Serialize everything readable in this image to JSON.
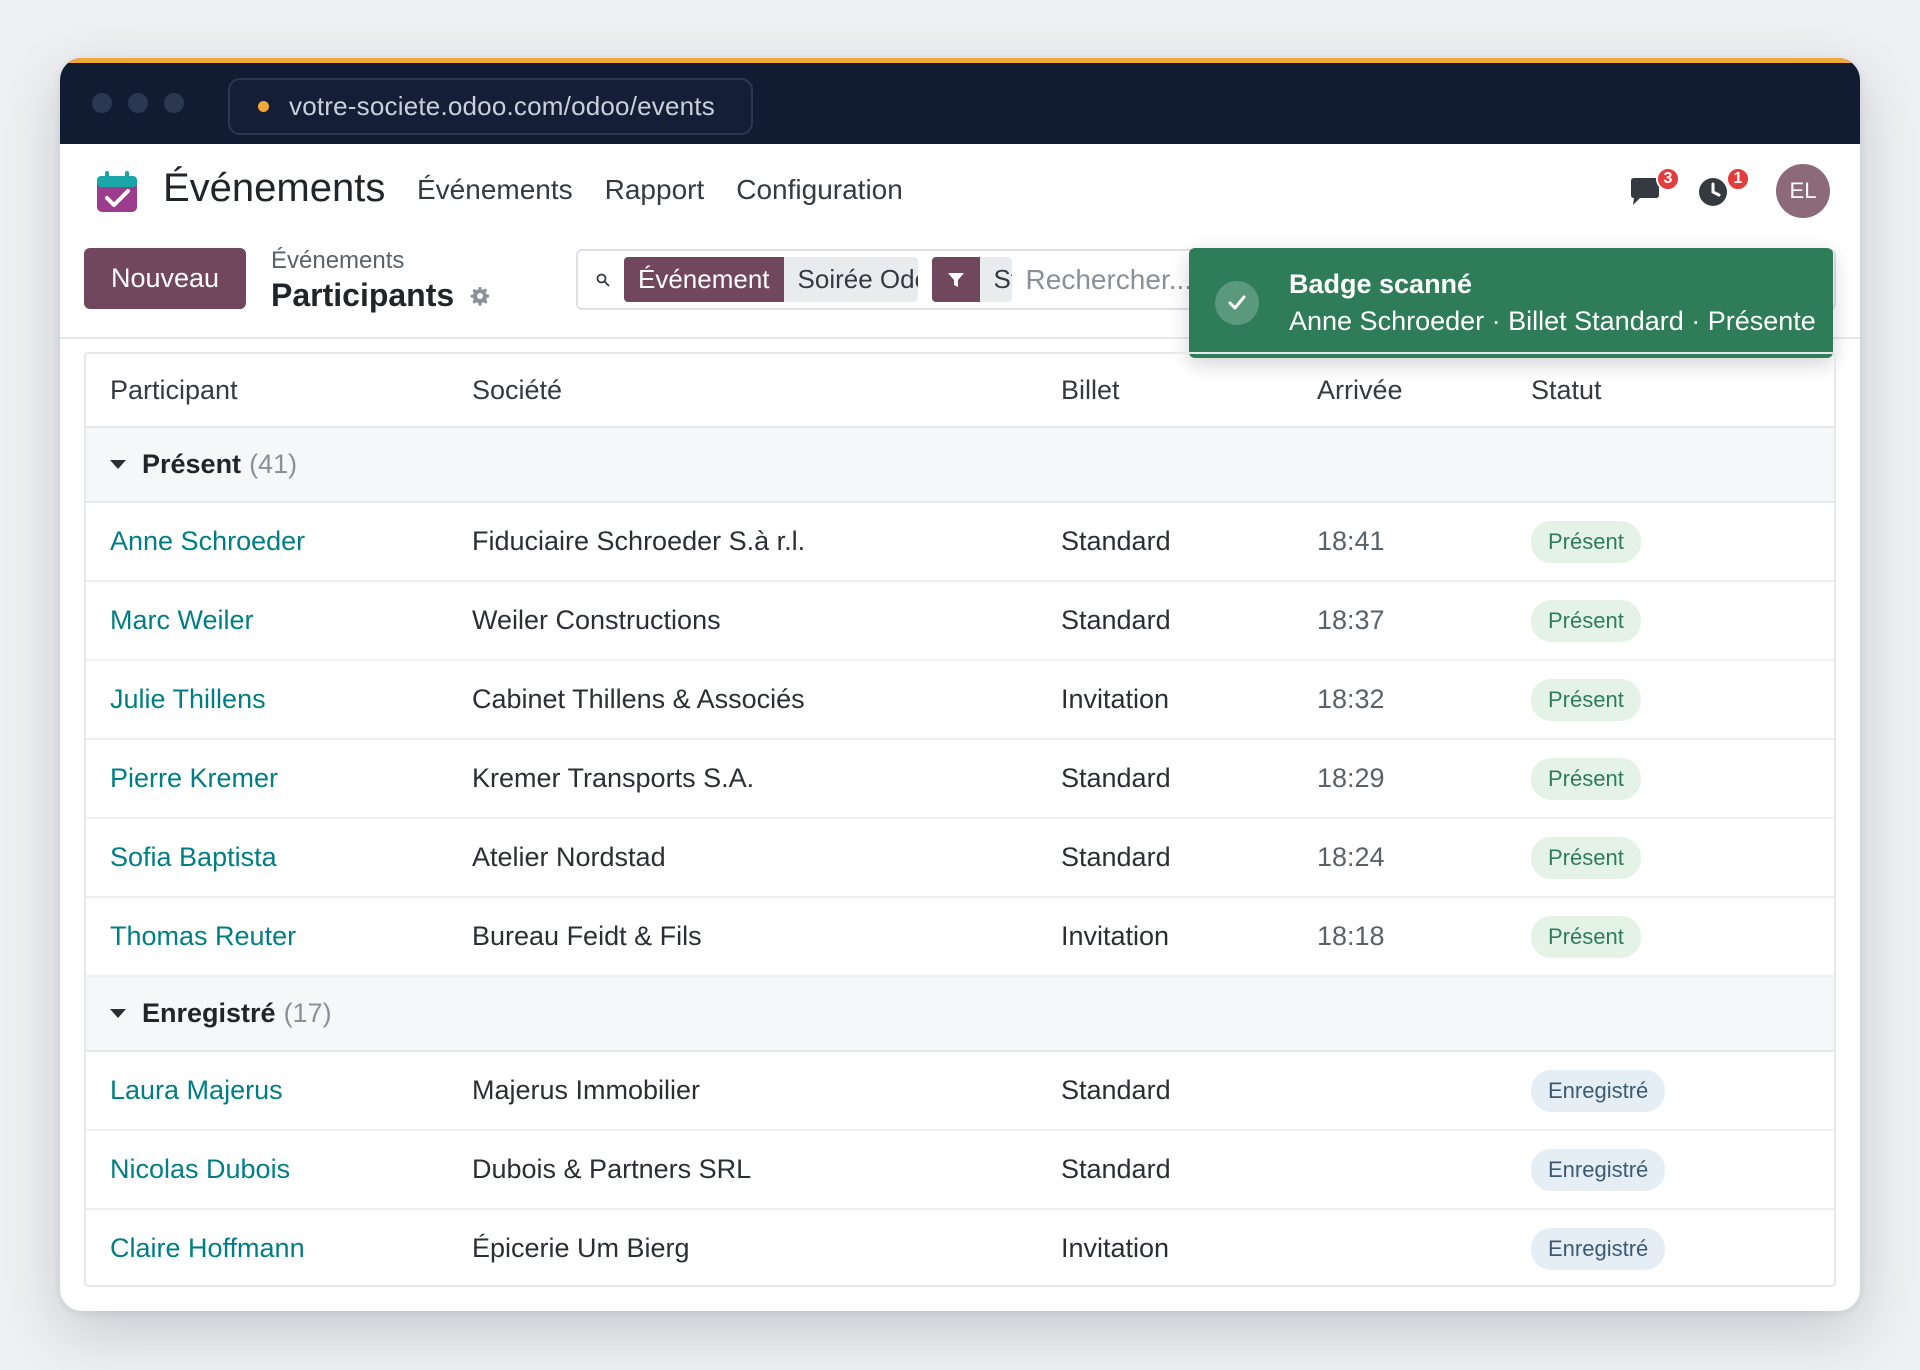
{
  "browser": {
    "url": "votre-societe.odoo.com/odoo/events",
    "accent_color": "#f1a73a"
  },
  "topnav": {
    "app_name": "Événements",
    "menu": [
      "Événements",
      "Rapport",
      "Configuration"
    ],
    "messages_badge": "3",
    "activities_badge": "1",
    "avatar_initials": "EL"
  },
  "control": {
    "new_button": "Nouveau",
    "breadcrumb_parent": "Événements",
    "breadcrumb_current": "Participants",
    "facet_label": "Événement",
    "facet_value": "Soirée Odoo",
    "facet2_value": "St",
    "search_placeholder": "Rechercher..."
  },
  "toast": {
    "title": "Badge scanné",
    "message": "Anne Schroeder · Billet Standard · Présente",
    "color": "#2e7d58"
  },
  "table": {
    "headers": [
      "Participant",
      "Société",
      "Billet",
      "Arrivée",
      "Statut"
    ],
    "groups": [
      {
        "label": "Présent",
        "count": "(41)",
        "rows": [
          {
            "name": "Anne Schroeder",
            "company": "Fiduciaire Schroeder S.à r.l.",
            "ticket": "Standard",
            "arrival": "18:41",
            "status": "Présent"
          },
          {
            "name": "Marc Weiler",
            "company": "Weiler Constructions",
            "ticket": "Standard",
            "arrival": "18:37",
            "status": "Présent"
          },
          {
            "name": "Julie Thillens",
            "company": "Cabinet Thillens & Associés",
            "ticket": "Invitation",
            "arrival": "18:32",
            "status": "Présent"
          },
          {
            "name": "Pierre Kremer",
            "company": "Kremer Transports S.A.",
            "ticket": "Standard",
            "arrival": "18:29",
            "status": "Présent"
          },
          {
            "name": "Sofia Baptista",
            "company": "Atelier Nordstad",
            "ticket": "Standard",
            "arrival": "18:24",
            "status": "Présent"
          },
          {
            "name": "Thomas Reuter",
            "company": "Bureau Feidt & Fils",
            "ticket": "Invitation",
            "arrival": "18:18",
            "status": "Présent"
          }
        ]
      },
      {
        "label": "Enregistré",
        "count": "(17)",
        "rows": [
          {
            "name": "Laura Majerus",
            "company": "Majerus Immobilier",
            "ticket": "Standard",
            "arrival": "",
            "status": "Enregistré"
          },
          {
            "name": "Nicolas Dubois",
            "company": "Dubois & Partners SRL",
            "ticket": "Standard",
            "arrival": "",
            "status": "Enregistré"
          },
          {
            "name": "Claire Hoffmann",
            "company": "Épicerie Um Bierg",
            "ticket": "Invitation",
            "arrival": "",
            "status": "Enregistré"
          }
        ]
      }
    ]
  },
  "colors": {
    "primary": "#71475e",
    "link": "#017e84",
    "browser_bar": "#111c33"
  }
}
